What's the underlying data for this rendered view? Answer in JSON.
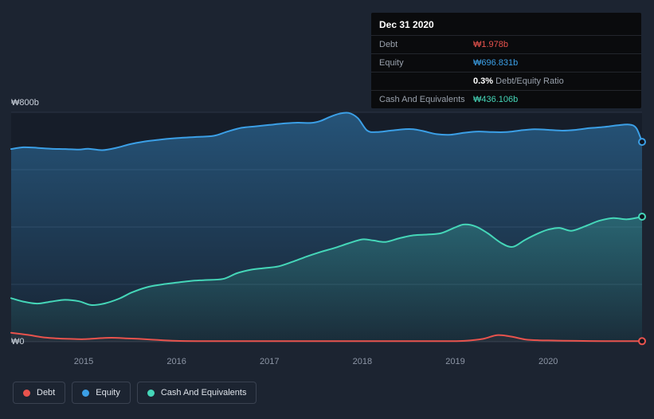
{
  "tooltip": {
    "date": "Dec 31 2020",
    "debt": {
      "label": "Debt",
      "value": "₩1.978b",
      "color": "#e8534d"
    },
    "equity": {
      "label": "Equity",
      "value": "₩696.831b",
      "color": "#3b9fe6"
    },
    "ratio": {
      "strong": "0.3%",
      "rest": " Debt/Equity Ratio"
    },
    "cash": {
      "label": "Cash And Equivalents",
      "value": "₩436.106b",
      "color": "#45d6b8"
    }
  },
  "legend": [
    {
      "label": "Debt",
      "color": "#e8534d"
    },
    {
      "label": "Equity",
      "color": "#3b9fe6"
    },
    {
      "label": "Cash And Equivalents",
      "color": "#45d6b8"
    }
  ],
  "chart_data": {
    "type": "area",
    "title": "",
    "xlabel": "",
    "ylabel": "",
    "xlim": [
      2014.22,
      2021.01
    ],
    "ylim": [
      0,
      800
    ],
    "grid": true,
    "legend_position": "bottom-left",
    "grid_values": [
      0,
      200,
      400,
      600,
      800
    ],
    "y_ticks": [
      {
        "value": 800,
        "label": "₩800b"
      },
      {
        "value": 0,
        "label": "₩0"
      }
    ],
    "x_ticks": [
      {
        "value": 2015,
        "label": "2015"
      },
      {
        "value": 2016,
        "label": "2016"
      },
      {
        "value": 2017,
        "label": "2017"
      },
      {
        "value": 2018,
        "label": "2018"
      },
      {
        "value": 2019,
        "label": "2019"
      },
      {
        "value": 2020,
        "label": "2020"
      }
    ],
    "series": [
      {
        "name": "Equity",
        "color": "#3b9fe6",
        "points": [
          [
            2014.22,
            672
          ],
          [
            2014.35,
            678
          ],
          [
            2014.5,
            676
          ],
          [
            2014.65,
            673
          ],
          [
            2014.8,
            672
          ],
          [
            2014.95,
            670
          ],
          [
            2015.05,
            673
          ],
          [
            2015.2,
            668
          ],
          [
            2015.35,
            676
          ],
          [
            2015.5,
            689
          ],
          [
            2015.65,
            698
          ],
          [
            2015.8,
            704
          ],
          [
            2016.0,
            710
          ],
          [
            2016.2,
            714
          ],
          [
            2016.4,
            718
          ],
          [
            2016.55,
            733
          ],
          [
            2016.7,
            746
          ],
          [
            2016.85,
            751
          ],
          [
            2017.0,
            756
          ],
          [
            2017.15,
            761
          ],
          [
            2017.3,
            764
          ],
          [
            2017.45,
            763
          ],
          [
            2017.55,
            770
          ],
          [
            2017.65,
            784
          ],
          [
            2017.75,
            795
          ],
          [
            2017.85,
            798
          ],
          [
            2017.95,
            780
          ],
          [
            2018.05,
            737
          ],
          [
            2018.15,
            731
          ],
          [
            2018.3,
            736
          ],
          [
            2018.45,
            741
          ],
          [
            2018.55,
            741
          ],
          [
            2018.65,
            735
          ],
          [
            2018.8,
            724
          ],
          [
            2018.95,
            722
          ],
          [
            2019.1,
            729
          ],
          [
            2019.25,
            733
          ],
          [
            2019.4,
            731
          ],
          [
            2019.55,
            731
          ],
          [
            2019.7,
            737
          ],
          [
            2019.85,
            741
          ],
          [
            2020.0,
            739
          ],
          [
            2020.15,
            736
          ],
          [
            2020.3,
            739
          ],
          [
            2020.45,
            745
          ],
          [
            2020.6,
            749
          ],
          [
            2020.75,
            755
          ],
          [
            2020.88,
            757
          ],
          [
            2020.95,
            744
          ],
          [
            2021.01,
            697
          ]
        ]
      },
      {
        "name": "Cash And Equivalents",
        "color": "#45d6b8",
        "points": [
          [
            2014.22,
            152
          ],
          [
            2014.35,
            140
          ],
          [
            2014.5,
            133
          ],
          [
            2014.65,
            140
          ],
          [
            2014.8,
            146
          ],
          [
            2014.95,
            141
          ],
          [
            2015.08,
            128
          ],
          [
            2015.22,
            133
          ],
          [
            2015.38,
            150
          ],
          [
            2015.52,
            172
          ],
          [
            2015.68,
            190
          ],
          [
            2015.85,
            200
          ],
          [
            2016.0,
            206
          ],
          [
            2016.15,
            212
          ],
          [
            2016.3,
            215
          ],
          [
            2016.5,
            219
          ],
          [
            2016.65,
            239
          ],
          [
            2016.8,
            251
          ],
          [
            2016.95,
            257
          ],
          [
            2017.1,
            263
          ],
          [
            2017.25,
            279
          ],
          [
            2017.4,
            297
          ],
          [
            2017.55,
            313
          ],
          [
            2017.7,
            327
          ],
          [
            2017.85,
            343
          ],
          [
            2018.0,
            357
          ],
          [
            2018.12,
            353
          ],
          [
            2018.25,
            348
          ],
          [
            2018.4,
            361
          ],
          [
            2018.55,
            371
          ],
          [
            2018.7,
            374
          ],
          [
            2018.85,
            379
          ],
          [
            2019.0,
            399
          ],
          [
            2019.1,
            409
          ],
          [
            2019.22,
            402
          ],
          [
            2019.35,
            378
          ],
          [
            2019.5,
            343
          ],
          [
            2019.62,
            331
          ],
          [
            2019.75,
            355
          ],
          [
            2019.9,
            379
          ],
          [
            2020.0,
            391
          ],
          [
            2020.12,
            397
          ],
          [
            2020.25,
            387
          ],
          [
            2020.4,
            403
          ],
          [
            2020.55,
            422
          ],
          [
            2020.7,
            431
          ],
          [
            2020.85,
            427
          ],
          [
            2021.01,
            436
          ]
        ]
      },
      {
        "name": "Debt",
        "color": "#e8534d",
        "points": [
          [
            2014.22,
            31
          ],
          [
            2014.4,
            24
          ],
          [
            2014.55,
            16
          ],
          [
            2014.7,
            12
          ],
          [
            2014.85,
            10
          ],
          [
            2015.0,
            9
          ],
          [
            2015.15,
            12
          ],
          [
            2015.3,
            14
          ],
          [
            2015.45,
            12
          ],
          [
            2015.6,
            10
          ],
          [
            2015.8,
            6
          ],
          [
            2016.0,
            3
          ],
          [
            2016.3,
            2
          ],
          [
            2016.6,
            2
          ],
          [
            2017.0,
            2
          ],
          [
            2017.5,
            2
          ],
          [
            2018.0,
            2
          ],
          [
            2018.5,
            2
          ],
          [
            2018.9,
            2
          ],
          [
            2019.1,
            3
          ],
          [
            2019.3,
            10
          ],
          [
            2019.45,
            23
          ],
          [
            2019.6,
            18
          ],
          [
            2019.75,
            8
          ],
          [
            2019.9,
            5
          ],
          [
            2020.1,
            4
          ],
          [
            2020.3,
            3
          ],
          [
            2020.6,
            2
          ],
          [
            2020.8,
            2
          ],
          [
            2021.01,
            2
          ]
        ]
      }
    ]
  }
}
